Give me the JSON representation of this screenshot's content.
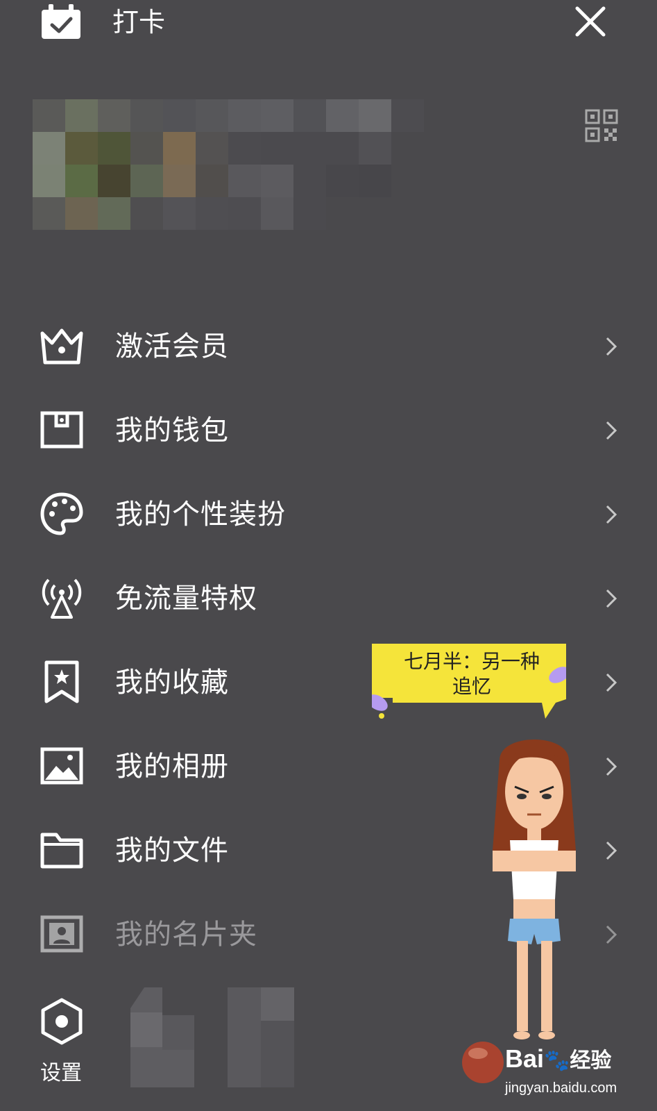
{
  "header": {
    "checkin_label": "打卡",
    "checkin_icon": "calendar-check-icon",
    "close_icon": "close-icon",
    "qr_icon": "qr-code-icon"
  },
  "menu": {
    "items": [
      {
        "label": "激活会员",
        "icon": "crown-icon"
      },
      {
        "label": "我的钱包",
        "icon": "wallet-icon"
      },
      {
        "label": "我的个性装扮",
        "icon": "palette-icon"
      },
      {
        "label": "免流量特权",
        "icon": "signal-tower-icon"
      },
      {
        "label": "我的收藏",
        "icon": "bookmark-star-icon"
      },
      {
        "label": "我的相册",
        "icon": "image-icon"
      },
      {
        "label": "我的文件",
        "icon": "folder-icon"
      },
      {
        "label": "我的名片夹",
        "icon": "contact-card-icon"
      }
    ]
  },
  "footer": {
    "settings_label": "设置",
    "settings_icon": "settings-hexagon-icon"
  },
  "sticker": {
    "bubble_text_line1": "七月半：另一种",
    "bubble_text_line2": "追忆"
  },
  "watermark": {
    "logo": "Bai",
    "logo_suffix": "经验",
    "site": "jingyan.baidu.com"
  },
  "colors": {
    "background": "#4a494c",
    "text": "#ffffff",
    "dim_text": "#9a999c",
    "bubble": "#f5e43a"
  }
}
